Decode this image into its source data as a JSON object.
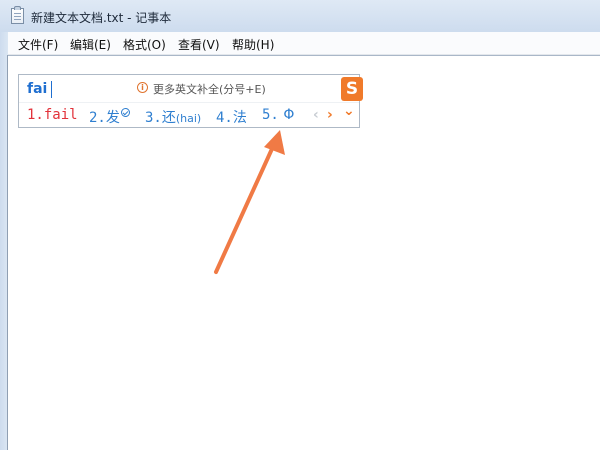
{
  "window": {
    "title": "新建文本文档.txt - 记事本"
  },
  "menu": [
    "文件(F)",
    "编辑(E)",
    "格式(O)",
    "查看(V)",
    "帮助(H)"
  ],
  "ime": {
    "input": "fai",
    "hint": "更多英文补全(分号+E)",
    "logo": "S",
    "candidates": [
      {
        "num": "1.",
        "text": "fail"
      },
      {
        "num": "2.",
        "text": "发"
      },
      {
        "num": "3.",
        "text": "还",
        "pinyin": "(hai)"
      },
      {
        "num": "4.",
        "text": "法"
      },
      {
        "num": "5.",
        "text": "Φ"
      }
    ],
    "nav_prev": "‹",
    "nav_next": "›",
    "expand": "⌄"
  },
  "colors": {
    "candidate_highlight": "#e2323a",
    "candidate_normal": "#2f7fd0",
    "logo_bg": "#f07a2a",
    "annotation_arrow": "#f07a45"
  }
}
